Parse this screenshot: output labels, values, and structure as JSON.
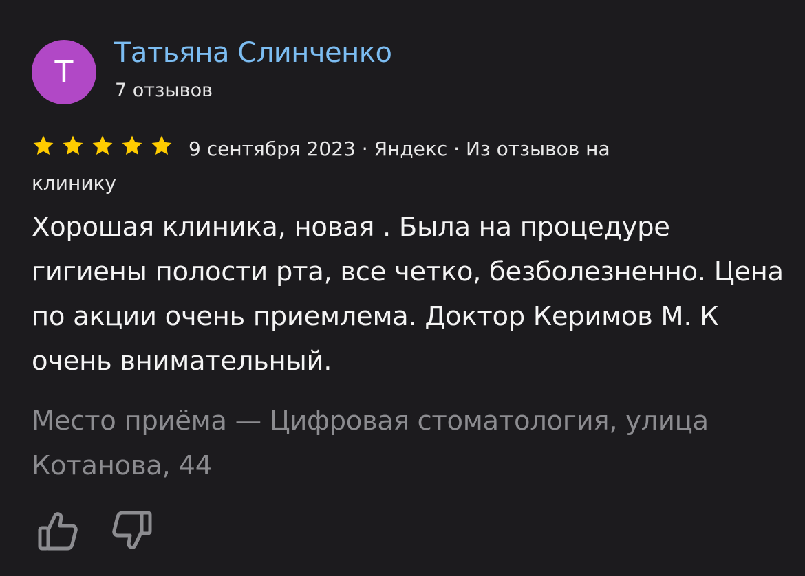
{
  "author": {
    "avatar_letter": "Т",
    "avatar_color": "#b148c6",
    "name": "Татьяна Слинченко",
    "name_color": "#7cbdf2",
    "reviews_count": "7 отзывов"
  },
  "rating": {
    "stars": 5,
    "max": 5,
    "star_color": "#ffcc00"
  },
  "meta": {
    "date": "9 сентября 2023",
    "separator": "·",
    "source": "Яндекс",
    "origin": "Из отзывов на клинику"
  },
  "review": {
    "text": "Хорошая клиника, новая . Была на процедуре гигиены полости рта, все четко, безболезненно. Цена по акции очень приемлема. Доктор Керимов М. К очень внимательный.",
    "place": "Место приёма — Цифровая стоматология, улица Котанова, 44"
  },
  "actions": {
    "like_icon": "thumbs-up-icon",
    "dislike_icon": "thumbs-down-icon"
  }
}
